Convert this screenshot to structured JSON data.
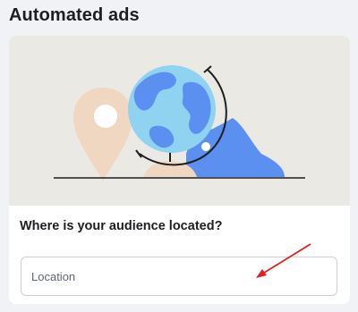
{
  "page": {
    "title": "Automated ads"
  },
  "audience": {
    "question": "Where is your audience located?",
    "location_placeholder": "Location",
    "location_value": ""
  },
  "icons": {
    "illustration": "globe-with-map-pin-illustration",
    "annotation": "red-arrow-icon"
  },
  "colors": {
    "hero_background": "#ebe9e4",
    "globe_ocean": "#8fd3f1",
    "globe_land": "#5b8ff0",
    "pin": "#f0d7c2",
    "annotation_arrow": "#e02020"
  }
}
